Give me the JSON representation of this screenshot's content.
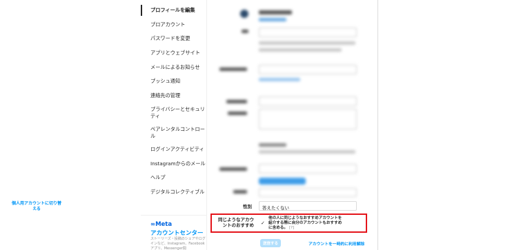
{
  "sidebar": {
    "items": [
      {
        "label": "プロフィールを編集",
        "active": true
      },
      {
        "label": "プロアカウント"
      },
      {
        "label": "パスワードを変更"
      },
      {
        "label": "アプリとウェブサイト"
      },
      {
        "label": "メールによるお知らせ"
      },
      {
        "label": "プッシュ通知"
      },
      {
        "label": "連絡先の管理"
      },
      {
        "label": "プライバシーとセキュリティ"
      },
      {
        "label": "ペアレンタルコントロール"
      },
      {
        "label": "ログインアクティビティ"
      },
      {
        "label": "Instagramからのメール"
      },
      {
        "label": "ヘルプ"
      },
      {
        "label": "デジタルコレクティブル"
      }
    ],
    "switch_link": "個人用アカウントに切り替える",
    "meta_logo": "∞Meta",
    "account_center_title": "アカウントセンター",
    "account_center_desc": "ストーリーズ・投稿のシェアやログインなど、Instagram、Facebookアプリ、Messenger間"
  },
  "form": {
    "gender_label": "性別",
    "gender_value": "答えたくない",
    "suggest_label": "同じようなアカウントのおすすめ",
    "suggest_checkmark": "✓",
    "suggest_desc": "他の人に同じようなおすすめアカウントを紹介する際に自分のアカウントもおすすめに含める。",
    "suggest_help": "[?]",
    "submit_label": "送信する",
    "deactivate_link": "アカウントを一時的に利用解除"
  },
  "colors": {
    "highlight": "#e4141b",
    "link": "#0095f6",
    "meta": "#0064e0"
  }
}
